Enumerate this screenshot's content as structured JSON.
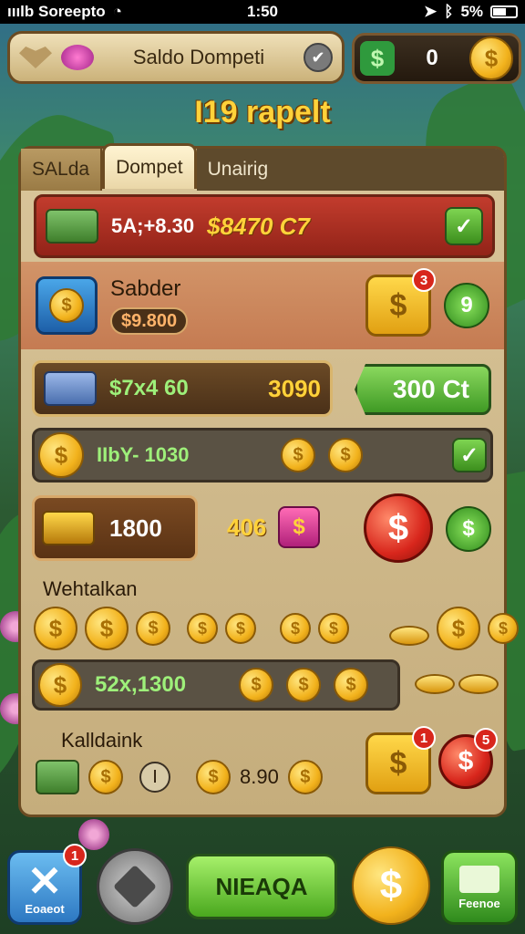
{
  "status_bar": {
    "carrier": "ııılb Soreepto",
    "time": "1:50",
    "battery": "5%"
  },
  "header": {
    "title": "Saldo Dompeti",
    "coin_balance": "0"
  },
  "page_heading": "I19 rapelt",
  "tabs": [
    "SALda",
    "Dompet",
    "Unairig"
  ],
  "rows": {
    "row1": {
      "left_value": "5A;+8.30",
      "right_value": "$8470 C7"
    },
    "row2": {
      "name": "Sabder",
      "amount": "$9.800",
      "badge": "3",
      "green_symbol": "9"
    },
    "row3": {
      "left_value": "$7x4 60",
      "right_value": "3090",
      "button": "300 Ct"
    },
    "row4": {
      "value": "IIbY- 1030"
    },
    "row5": {
      "amount": "1800",
      "mid_value": "406"
    }
  },
  "sections": {
    "withdraw": {
      "label": "Wehtalkan",
      "bar_value": "52x,1300"
    },
    "kalldank": {
      "label": "Kalldaink",
      "oval": "I",
      "value": "8.90",
      "badge_a": "1",
      "badge_b": "5"
    }
  },
  "bottom_nav": {
    "close_label": "Eoaeot",
    "close_badge": "1",
    "primary_button": "NIEAQA",
    "shop_label": "Feenoe"
  },
  "icons": {
    "coin": "$"
  },
  "colors": {
    "gold": "#ffd23a",
    "red": "#d8261c",
    "green": "#3f9a24",
    "blue": "#2d78c2"
  }
}
